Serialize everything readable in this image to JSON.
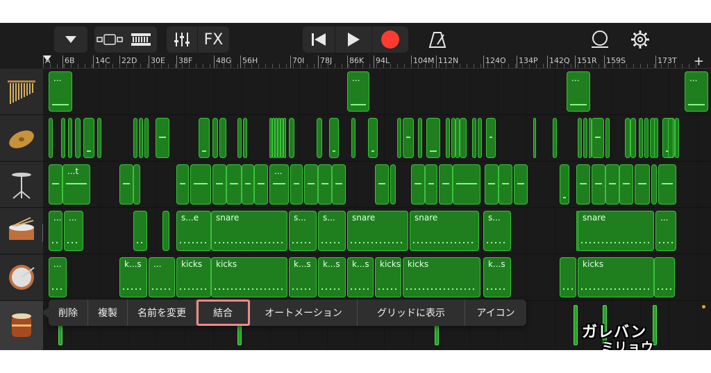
{
  "toolbar": {
    "view_menu_icon": "triangle-down-icon",
    "tracks_view_icon": "tracks-view-icon",
    "loop_browser_icon": "loop-browser-icon",
    "mixer_icon": "mixer-icon",
    "fx_label": "FX",
    "rewind_icon": "rewind-icon",
    "play_icon": "play-icon",
    "record_icon": "record-icon",
    "metronome_icon": "metronome-icon",
    "loop_icon": "loop-icon",
    "settings_icon": "gear-icon",
    "record_color": "#ff3b30"
  },
  "ruler": {
    "labels": [
      "A",
      "6B",
      "14C",
      "22D",
      "30E",
      "38F",
      "48G",
      "56H",
      "70I",
      "78J",
      "86K",
      "94L",
      "104M",
      "112N",
      "124O",
      "134P",
      "142Q",
      "151R",
      "159S",
      "173T"
    ],
    "plus_label": "+"
  },
  "tracks": [
    {
      "name": "chimes",
      "icon": "chimes-icon"
    },
    {
      "name": "cymbal",
      "icon": "cymbal-icon"
    },
    {
      "name": "hihat",
      "icon": "hihat-icon"
    },
    {
      "name": "snare",
      "icon": "snare-drum-icon"
    },
    {
      "name": "kick",
      "icon": "kick-drum-icon"
    },
    {
      "name": "taiko",
      "icon": "taiko-drum-icon"
    }
  ],
  "regions": {
    "chimes": [
      "...",
      "...",
      "...",
      "..."
    ],
    "hihat": [
      "...t",
      "..."
    ],
    "snare": [
      "...",
      "...",
      "s...e",
      "snare",
      "s...",
      "s...",
      "snare",
      "snare",
      "s...",
      "...",
      "snare",
      "..."
    ],
    "kick": [
      "...",
      "k...s",
      "...",
      "kicks",
      "kicks",
      "k...s",
      "k...s",
      "k...s",
      "kicks",
      "kicks",
      "k...s",
      "kicks"
    ]
  },
  "context_menu": {
    "items": [
      "削除",
      "複製",
      "名前を変更",
      "結合",
      "オートメーション",
      "グリッドに表示",
      "アイコン"
    ],
    "highlighted": "結合",
    "highlight_color": "#f08a8a"
  },
  "watermark": {
    "line1": "ガレバン",
    "line2": "ミリョウ"
  },
  "colors": {
    "region_fill": "#1f7f1f",
    "region_border": "#39c439",
    "background": "#1c1c1c"
  }
}
